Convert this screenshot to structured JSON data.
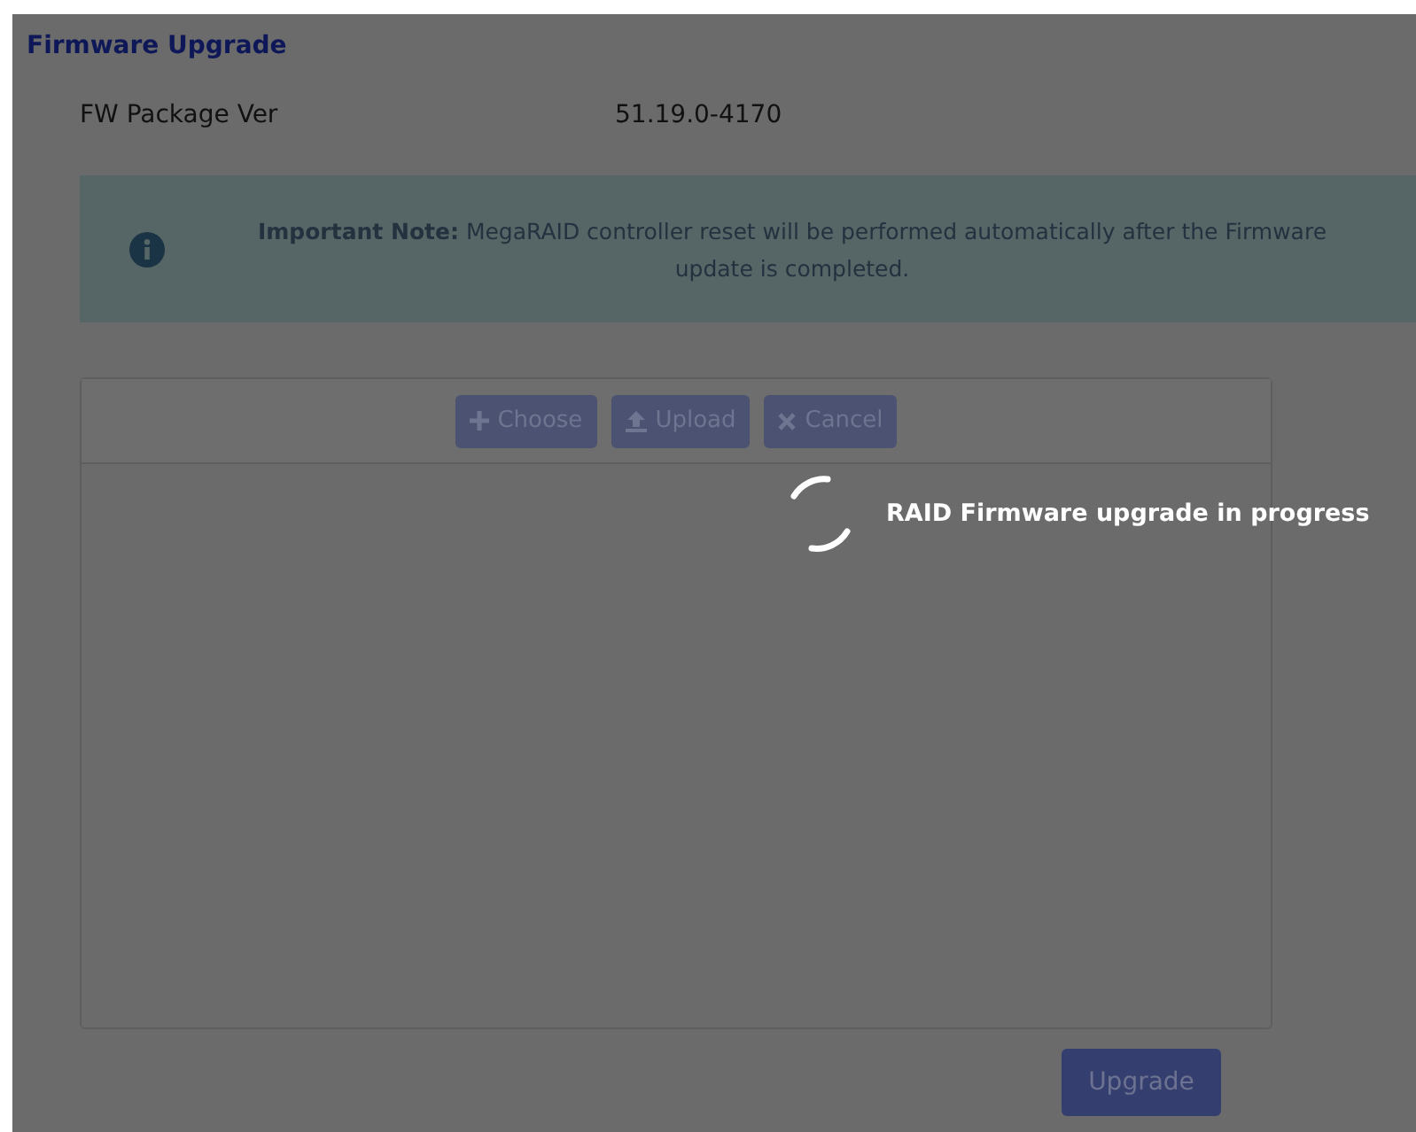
{
  "page": {
    "title": "Firmware Upgrade"
  },
  "package": {
    "label": "FW Package Ver",
    "value": "51.19.0-4170"
  },
  "note": {
    "text": "**Important Note:** MegaRAID controller reset will be performed automatically after the Firmware update is completed."
  },
  "uploader": {
    "buttons": [
      {
        "kind": "choose",
        "label": "Choose",
        "disabled": true
      },
      {
        "kind": "upload",
        "label": "Upload",
        "disabled": true
      },
      {
        "kind": "cancel",
        "label": "Cancel",
        "disabled": true
      }
    ]
  },
  "progress": {
    "message": "RAID Firmware upgrade in progress"
  },
  "upgrade_button": {
    "label": "Upgrade",
    "disabled": true
  }
}
